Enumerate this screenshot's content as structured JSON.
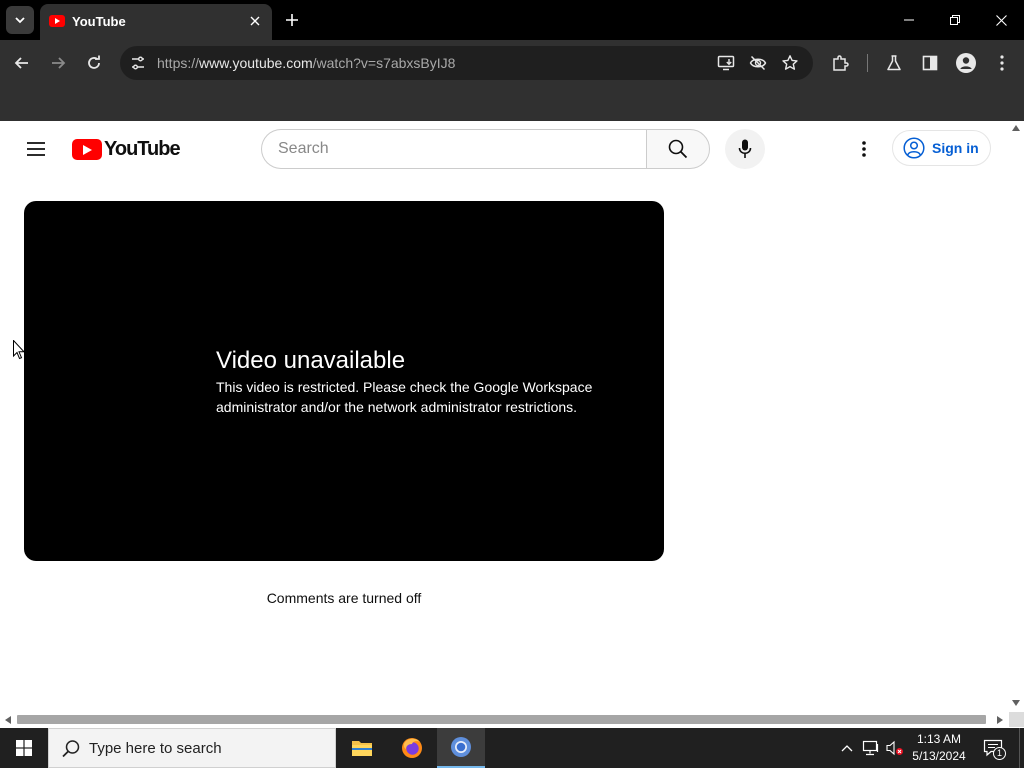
{
  "browser": {
    "tab": {
      "title": "YouTube",
      "favicon": "youtube-favicon-icon"
    },
    "url": {
      "scheme": "https://",
      "host": "www.youtube.com",
      "path": "/watch?v=s7abxsByIJ8"
    },
    "colors": {
      "tabstrip": "#000000",
      "toolbar": "#303030",
      "omnibox": "#1f1f1f"
    }
  },
  "youtube": {
    "logo_text": "YouTube",
    "search": {
      "placeholder": "Search",
      "value": ""
    },
    "signin_label": "Sign in",
    "player": {
      "error_title": "Video unavailable",
      "error_message": "This video is restricted. Please check the Google Workspace administrator and/or the network administrator restrictions."
    },
    "comments_status": "Comments are turned off",
    "colors": {
      "brand": "#ff0000",
      "link": "#065fd4"
    }
  },
  "taskbar": {
    "search_placeholder": "Type here to search",
    "apps": [
      "file-explorer-icon",
      "firefox-icon",
      "chrome-icon"
    ],
    "clock": {
      "time": "1:13 AM",
      "date": "5/13/2024"
    },
    "notification_count": "1"
  }
}
